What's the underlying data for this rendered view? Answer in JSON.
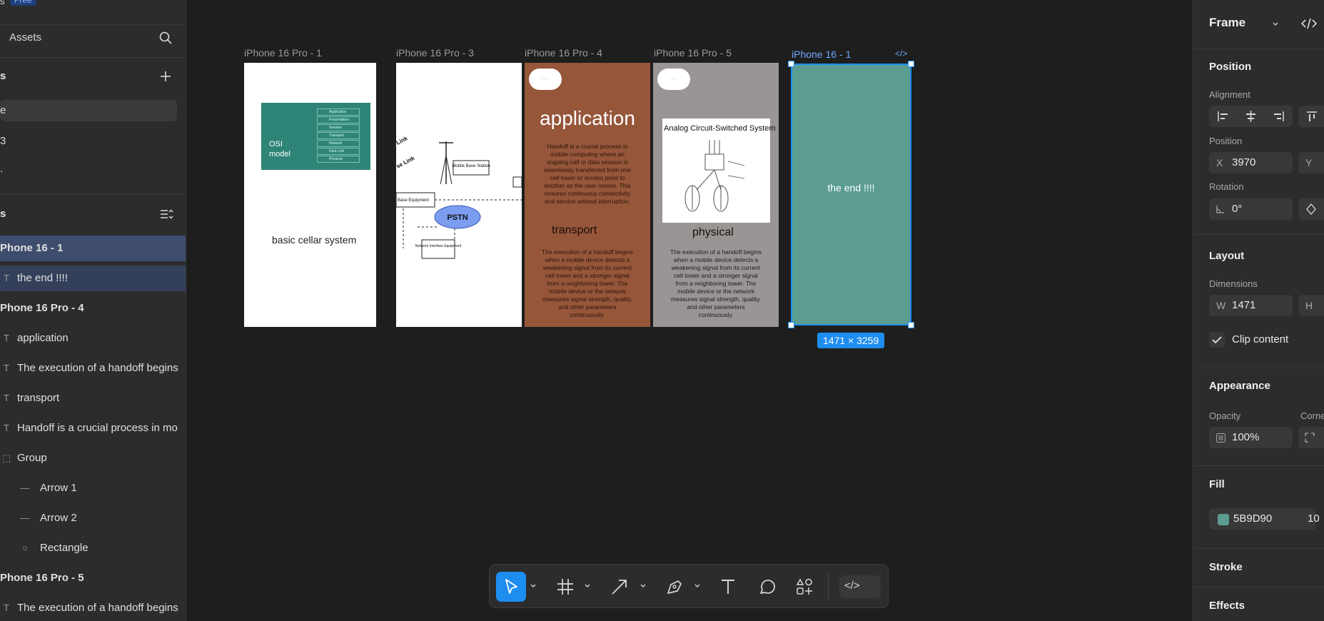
{
  "left_panel": {
    "plan_badge": "Free",
    "plan_prefix": "s",
    "assets_label": "Assets",
    "pages_header": "s",
    "pages": [
      {
        "label": "e",
        "selected": true
      },
      {
        "label": "3",
        "selected": false
      },
      {
        "label": ".",
        "selected": false
      }
    ],
    "layers_header": "s",
    "layers": [
      {
        "label": "Phone 16 - 1",
        "kind": "frame",
        "indent": 0,
        "highlight": "primary"
      },
      {
        "label": "the end !!!!",
        "kind": "text",
        "indent": 1,
        "highlight": "secondary"
      },
      {
        "label": "Phone 16 Pro - 4",
        "kind": "frame",
        "indent": 0,
        "highlight": "none"
      },
      {
        "label": "application",
        "kind": "text",
        "indent": 1,
        "highlight": "none"
      },
      {
        "label": "The execution of a handoff begins",
        "kind": "text",
        "indent": 1,
        "highlight": "none"
      },
      {
        "label": "transport",
        "kind": "text",
        "indent": 1,
        "highlight": "none"
      },
      {
        "label": "Handoff is a crucial process in mo",
        "kind": "text",
        "indent": 1,
        "highlight": "none"
      },
      {
        "label": "Group",
        "kind": "group",
        "indent": 1,
        "highlight": "none"
      },
      {
        "label": "Arrow 1",
        "kind": "line",
        "indent": 2,
        "highlight": "none"
      },
      {
        "label": "Arrow 2",
        "kind": "line",
        "indent": 2,
        "highlight": "none"
      },
      {
        "label": "Rectangle",
        "kind": "ellipse",
        "indent": 2,
        "highlight": "none"
      },
      {
        "label": "Phone 16 Pro - 5",
        "kind": "frame",
        "indent": 0,
        "highlight": "none"
      },
      {
        "label": "The execution of a handoff begins",
        "kind": "text",
        "indent": 1,
        "highlight": "none"
      }
    ]
  },
  "canvas": {
    "frames": {
      "f1": {
        "label": "iPhone 16 Pro - 1",
        "osi_text": "OSI model",
        "body_text": "basic cellar system",
        "osi_layers": [
          "Application",
          "Presentation",
          "Session",
          "Transport",
          "Network",
          "Data Link",
          "Physical"
        ]
      },
      "f3": {
        "label": "iPhone 16 Pro - 3",
        "cloud_text": "PSTN",
        "node1": "Mobile Base Station",
        "node2": "Network Interface Equipment",
        "node3": "Base Equipment",
        "link1": "Link",
        "link2": "se Link"
      },
      "f4": {
        "label": "iPhone 16 Pro - 4",
        "title": "application",
        "para1": "Handoff is a crucial process in mobile computing where an ongoing call or data session is seamlessly transferred from one cell tower or access point to another as the user moves. This ensures continuous connectivity and service without interruption.",
        "subtitle": "transport",
        "para2": "The execution of a handoff begins when a mobile device detects a weakening signal from its current cell tower and a stronger signal from a neighboring tower. The mobile device or the network measures signal strength, quality, and other parameters continuously."
      },
      "f5": {
        "label": "iPhone 16 Pro - 5",
        "diagram_title": "Analog Circuit-Switched System",
        "subtitle": "physical",
        "para": "The execution of a handoff begins when a mobile device detects a weakening signal from its current cell tower and a stronger signal from a neighboring tower. The mobile device or the network measures signal strength, quality, and other parameters continuously."
      },
      "f6": {
        "label": "iPhone 16 - 1",
        "text": "the end !!!!",
        "code_glyph": "</>"
      }
    },
    "selection_size": "1471 × 3259"
  },
  "toolbar": {
    "tools": [
      "move-tool",
      "frame-tool",
      "arrow-tool",
      "pen-tool",
      "text-tool",
      "comment-tool",
      "actions-tool"
    ],
    "active_tool": "move-tool",
    "dev_mode_glyph": "</>"
  },
  "right_panel": {
    "header": "Frame",
    "position_section": "Position",
    "alignment_label": "Alignment",
    "position_label": "Position",
    "x_prefix": "X",
    "x_value": "3970",
    "y_prefix": "Y",
    "rotation_label": "Rotation",
    "rotation_value": "0°",
    "layout_section": "Layout",
    "dimensions_label": "Dimensions",
    "w_prefix": "W",
    "w_value": "1471",
    "h_prefix": "H",
    "clip_content_label": "Clip content",
    "clip_content_checked": true,
    "appearance_section": "Appearance",
    "opacity_label": "Opacity",
    "opacity_value": "100%",
    "corner_label": "Corne",
    "fill_section": "Fill",
    "fill_hex": "5B9D90",
    "fill_opacity": "10",
    "fill_color": "#5b9d90",
    "stroke_section": "Stroke",
    "effects_section": "Effects"
  },
  "colors": {
    "accent": "#1d8ef0",
    "frame4_bg": "#96563a",
    "frame5_bg": "#9a9595",
    "osi_card": "#2f8478"
  }
}
